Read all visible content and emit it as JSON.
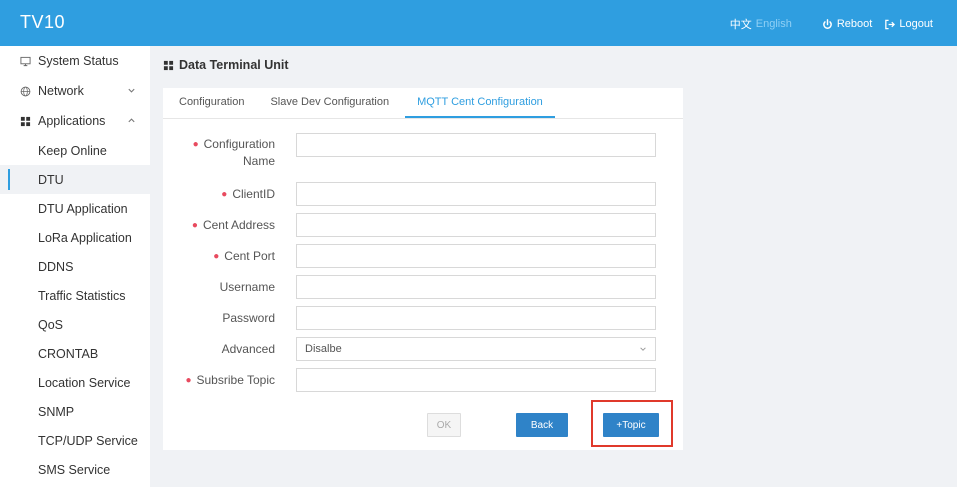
{
  "header": {
    "brand": "TV10",
    "lang_cn": "中文",
    "lang_en": "English",
    "reboot": "Reboot",
    "logout": "Logout"
  },
  "sidebar": {
    "items": [
      {
        "label": "System Status",
        "icon": "monitor-icon"
      },
      {
        "label": "Network",
        "icon": "globe-icon"
      },
      {
        "label": "Applications",
        "icon": "grid-icon"
      },
      {
        "label": "Keep Online"
      },
      {
        "label": "DTU",
        "active": true
      },
      {
        "label": "DTU Application"
      },
      {
        "label": "LoRa Application"
      },
      {
        "label": "DDNS"
      },
      {
        "label": "Traffic Statistics"
      },
      {
        "label": "QoS"
      },
      {
        "label": "CRONTAB"
      },
      {
        "label": "Location Service"
      },
      {
        "label": "SNMP"
      },
      {
        "label": "TCP/UDP Service"
      },
      {
        "label": "SMS Service"
      }
    ]
  },
  "page": {
    "title": "Data Terminal Unit"
  },
  "tabs": [
    {
      "label": "Configuration"
    },
    {
      "label": "Slave Dev Configuration"
    },
    {
      "label": "MQTT Cent Configuration",
      "active": true
    }
  ],
  "form": {
    "config_name_label_1": "Configuration",
    "config_name_label_2": "Name",
    "clientid_label": "ClientID",
    "cent_address_label": "Cent Address",
    "cent_port_label": "Cent Port",
    "username_label": "Username",
    "password_label": "Password",
    "advanced_label": "Advanced",
    "advanced_value": "Disalbe",
    "subscribe_topic_label": "Subsribe Topic"
  },
  "buttons": {
    "ok": "OK",
    "back": "Back",
    "topic": "+Topic"
  },
  "colors": {
    "accent": "#2f9ee0",
    "button": "#2f83c8",
    "required": "#e84a5f",
    "highlight": "#e0392b"
  }
}
